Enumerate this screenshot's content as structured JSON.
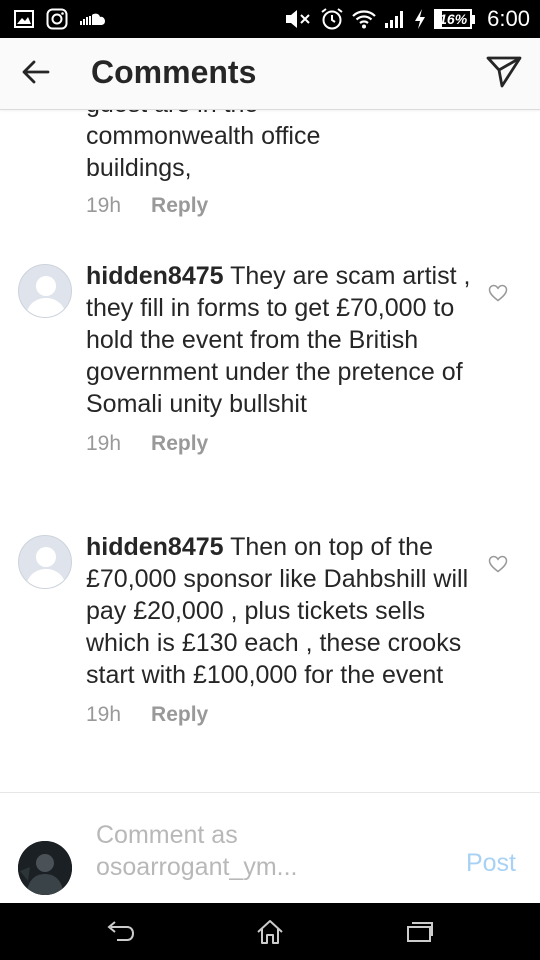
{
  "status_bar": {
    "left_icons": [
      "gallery-icon",
      "instagram-icon",
      "soundcloud-icon"
    ],
    "right_icons": [
      "mute-icon",
      "alarm-icon",
      "wifi-icon",
      "signal-icon",
      "charging-icon"
    ],
    "battery": "16%",
    "time": "6:00"
  },
  "header": {
    "title": "Comments",
    "back_icon": "back-arrow-icon",
    "share_icon": "direct-send-icon"
  },
  "partial_comment": {
    "text_lines": [
      "guest are in the",
      "commonwealth office",
      "buildings,"
    ],
    "time": "19h",
    "reply": "Reply"
  },
  "comments": [
    {
      "username": "hidden8475",
      "text": "They are scam artist , they fill in forms to get £70,000 to hold the event from the British government under the pretence of Somali unity bullshit",
      "time": "19h",
      "reply": "Reply"
    },
    {
      "username": "hidden8475",
      "text": "Then on top of the £70,000 sponsor like Dahbshill will pay £20,000 , plus tickets sells which is £130 each , these crooks start with £100,000 for the event",
      "time": "19h",
      "reply": "Reply"
    }
  ],
  "composer": {
    "placeholder": "Comment as osoarrogant_ym...",
    "post_label": "Post"
  },
  "nav_bar": {
    "icons": [
      "back-nav-icon",
      "home-icon",
      "recents-icon"
    ]
  },
  "colors": {
    "post_disabled": "#a8d2f5",
    "meta_gray": "#999999",
    "text": "#262626"
  }
}
